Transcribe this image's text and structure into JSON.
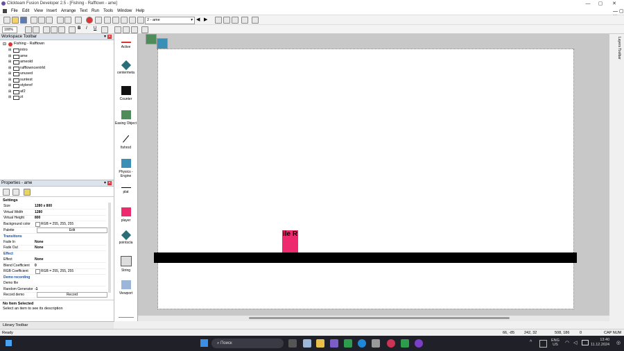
{
  "window": {
    "title": "Clickteam Fusion Developer 2.5 - [Fishing - Rafftown - ame]"
  },
  "menu": [
    "File",
    "Edit",
    "View",
    "Insert",
    "Arrange",
    "Text",
    "Run",
    "Tools",
    "Window",
    "Help"
  ],
  "toolbar": {
    "frame_select": "2 - ame",
    "zoom": "100%"
  },
  "workspace": {
    "header": "Workspace Toolbar",
    "root": "Fishing - Rafftown",
    "frames": [
      "intro",
      "ame",
      "ameold",
      "rafftowncentrld",
      "unused",
      "suntest",
      "styleref",
      "af2",
      "zt"
    ]
  },
  "properties": {
    "header": "Properties - ame",
    "settings_label": "Settings",
    "rows": [
      {
        "k": "Size",
        "v": "1280 x 800"
      },
      {
        "k": "Virtual Width",
        "v": "1280"
      },
      {
        "k": "Virtual Height",
        "v": "800"
      },
      {
        "k": "Background color",
        "v": "RGB = 255, 255, 255"
      },
      {
        "k": "Palette",
        "v": "Edit"
      }
    ],
    "transitions_label": "Transitions",
    "rows2": [
      {
        "k": "Fade In",
        "v": "None"
      },
      {
        "k": "Fade Out",
        "v": "None"
      }
    ],
    "effect_label": "Effect",
    "rows3": [
      {
        "k": "Effect",
        "v": "None"
      },
      {
        "k": "Blend Coefficient",
        "v": "0"
      },
      {
        "k": "RGB Coefficient",
        "v": "RGB = 255, 255, 255"
      }
    ],
    "demo_label": "Demo recording",
    "rows4": [
      {
        "k": "Demo file",
        "v": ""
      },
      {
        "k": "Random Generator",
        "v": "-1"
      },
      {
        "k": "Record demo",
        "v": "Record"
      }
    ],
    "info_title": "No Item Selected",
    "info_text": "Select an item to see its description"
  },
  "objects": [
    {
      "label": "Active",
      "icon": "active-icon"
    },
    {
      "label": "centermeta",
      "icon": "centermeta-icon"
    },
    {
      "label": "Counter",
      "icon": "counter-icon"
    },
    {
      "label": "Easing Object",
      "icon": "easing-icon"
    },
    {
      "label": "fishrod",
      "icon": "fishrod-icon"
    },
    {
      "label": "Physics - Engine",
      "icon": "physics-icon"
    },
    {
      "label": "plat",
      "icon": "plat-icon"
    },
    {
      "label": "player",
      "icon": "player-icon"
    },
    {
      "label": "pointscla",
      "icon": "pointscla-icon"
    },
    {
      "label": "String",
      "icon": "string-icon"
    },
    {
      "label": "Viewport",
      "icon": "viewport-icon"
    }
  ],
  "frame_player_text": "ile R",
  "library": "Library Toolbar",
  "layers_label": "Layers Toolbar",
  "status": {
    "left": "Ready",
    "pos1": "66, -85",
    "pos2": "242, 32",
    "pos3": "508, 186",
    "count": "0",
    "caps": "CAP NUM"
  },
  "taskbar": {
    "search": "Поиск",
    "lang": "ENG",
    "region": "US",
    "time": "13:40",
    "date": "11.12.2024"
  },
  "colors": {
    "accent": "#1a4fa0",
    "player": "#ee2a6e",
    "platform": "#000000",
    "taskbar": "#202028"
  }
}
